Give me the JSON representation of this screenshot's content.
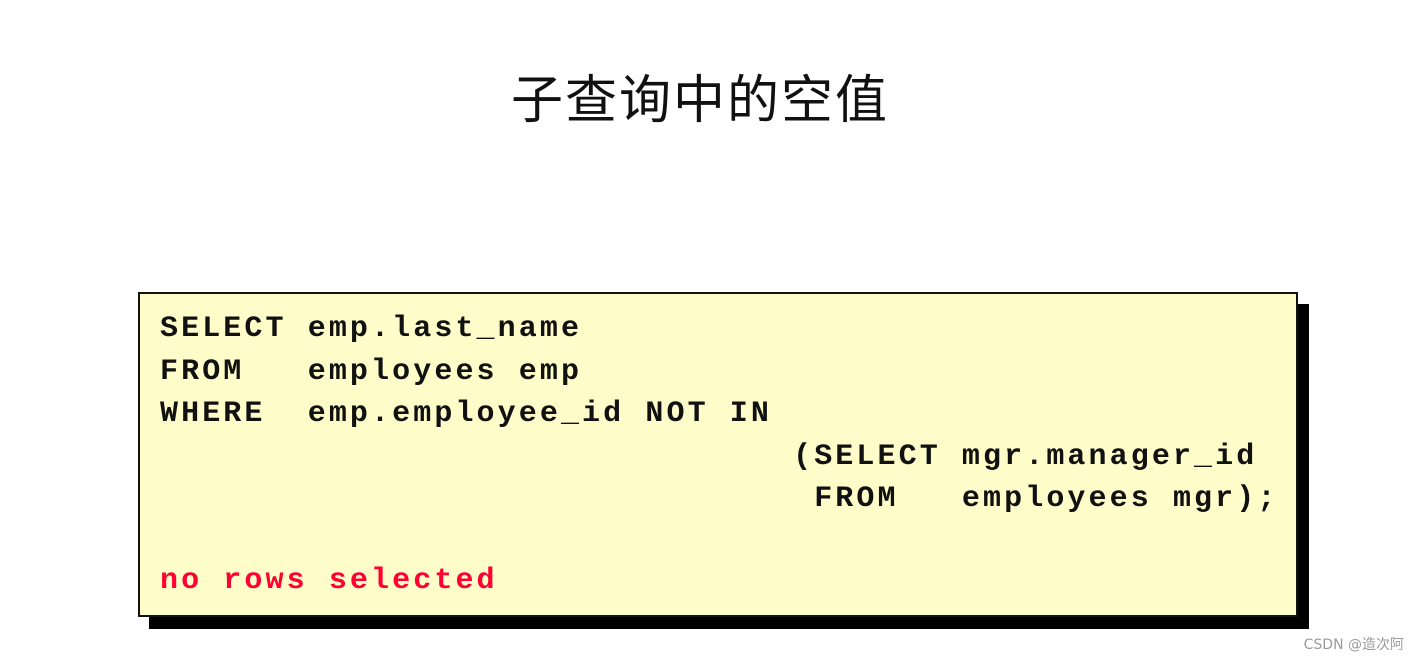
{
  "slide": {
    "title": "子查询中的空值",
    "code_lines": [
      "SELECT emp.last_name",
      "FROM   employees emp",
      "WHERE  emp.employee_id NOT IN",
      "                              (SELECT mgr.manager_id",
      "                               FROM   employees mgr);"
    ],
    "result_text": "no rows selected",
    "colors": {
      "code_background": "#fefcc9",
      "result_text": "#ff0033",
      "shadow": "#000000"
    }
  },
  "watermark": "CSDN @造次阿"
}
